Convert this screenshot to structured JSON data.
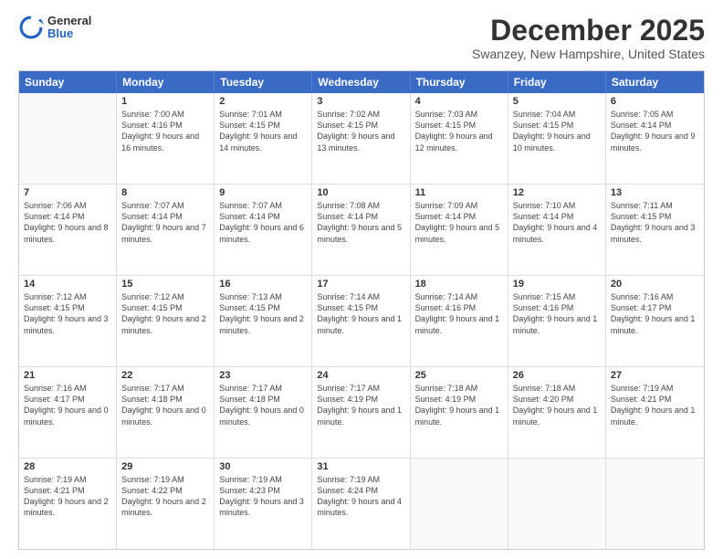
{
  "header": {
    "logo": {
      "general": "General",
      "blue": "Blue"
    },
    "month": "December 2025",
    "location": "Swanzey, New Hampshire, United States"
  },
  "days_of_week": [
    "Sunday",
    "Monday",
    "Tuesday",
    "Wednesday",
    "Thursday",
    "Friday",
    "Saturday"
  ],
  "weeks": [
    [
      {
        "day": "",
        "empty": true
      },
      {
        "day": "1",
        "sunrise": "Sunrise: 7:00 AM",
        "sunset": "Sunset: 4:16 PM",
        "daylight": "Daylight: 9 hours and 16 minutes."
      },
      {
        "day": "2",
        "sunrise": "Sunrise: 7:01 AM",
        "sunset": "Sunset: 4:15 PM",
        "daylight": "Daylight: 9 hours and 14 minutes."
      },
      {
        "day": "3",
        "sunrise": "Sunrise: 7:02 AM",
        "sunset": "Sunset: 4:15 PM",
        "daylight": "Daylight: 9 hours and 13 minutes."
      },
      {
        "day": "4",
        "sunrise": "Sunrise: 7:03 AM",
        "sunset": "Sunset: 4:15 PM",
        "daylight": "Daylight: 9 hours and 12 minutes."
      },
      {
        "day": "5",
        "sunrise": "Sunrise: 7:04 AM",
        "sunset": "Sunset: 4:15 PM",
        "daylight": "Daylight: 9 hours and 10 minutes."
      },
      {
        "day": "6",
        "sunrise": "Sunrise: 7:05 AM",
        "sunset": "Sunset: 4:14 PM",
        "daylight": "Daylight: 9 hours and 9 minutes."
      }
    ],
    [
      {
        "day": "7",
        "sunrise": "Sunrise: 7:06 AM",
        "sunset": "Sunset: 4:14 PM",
        "daylight": "Daylight: 9 hours and 8 minutes."
      },
      {
        "day": "8",
        "sunrise": "Sunrise: 7:07 AM",
        "sunset": "Sunset: 4:14 PM",
        "daylight": "Daylight: 9 hours and 7 minutes."
      },
      {
        "day": "9",
        "sunrise": "Sunrise: 7:07 AM",
        "sunset": "Sunset: 4:14 PM",
        "daylight": "Daylight: 9 hours and 6 minutes."
      },
      {
        "day": "10",
        "sunrise": "Sunrise: 7:08 AM",
        "sunset": "Sunset: 4:14 PM",
        "daylight": "Daylight: 9 hours and 5 minutes."
      },
      {
        "day": "11",
        "sunrise": "Sunrise: 7:09 AM",
        "sunset": "Sunset: 4:14 PM",
        "daylight": "Daylight: 9 hours and 5 minutes."
      },
      {
        "day": "12",
        "sunrise": "Sunrise: 7:10 AM",
        "sunset": "Sunset: 4:14 PM",
        "daylight": "Daylight: 9 hours and 4 minutes."
      },
      {
        "day": "13",
        "sunrise": "Sunrise: 7:11 AM",
        "sunset": "Sunset: 4:15 PM",
        "daylight": "Daylight: 9 hours and 3 minutes."
      }
    ],
    [
      {
        "day": "14",
        "sunrise": "Sunrise: 7:12 AM",
        "sunset": "Sunset: 4:15 PM",
        "daylight": "Daylight: 9 hours and 3 minutes."
      },
      {
        "day": "15",
        "sunrise": "Sunrise: 7:12 AM",
        "sunset": "Sunset: 4:15 PM",
        "daylight": "Daylight: 9 hours and 2 minutes."
      },
      {
        "day": "16",
        "sunrise": "Sunrise: 7:13 AM",
        "sunset": "Sunset: 4:15 PM",
        "daylight": "Daylight: 9 hours and 2 minutes."
      },
      {
        "day": "17",
        "sunrise": "Sunrise: 7:14 AM",
        "sunset": "Sunset: 4:15 PM",
        "daylight": "Daylight: 9 hours and 1 minute."
      },
      {
        "day": "18",
        "sunrise": "Sunrise: 7:14 AM",
        "sunset": "Sunset: 4:16 PM",
        "daylight": "Daylight: 9 hours and 1 minute."
      },
      {
        "day": "19",
        "sunrise": "Sunrise: 7:15 AM",
        "sunset": "Sunset: 4:16 PM",
        "daylight": "Daylight: 9 hours and 1 minute."
      },
      {
        "day": "20",
        "sunrise": "Sunrise: 7:16 AM",
        "sunset": "Sunset: 4:17 PM",
        "daylight": "Daylight: 9 hours and 1 minute."
      }
    ],
    [
      {
        "day": "21",
        "sunrise": "Sunrise: 7:16 AM",
        "sunset": "Sunset: 4:17 PM",
        "daylight": "Daylight: 9 hours and 0 minutes."
      },
      {
        "day": "22",
        "sunrise": "Sunrise: 7:17 AM",
        "sunset": "Sunset: 4:18 PM",
        "daylight": "Daylight: 9 hours and 0 minutes."
      },
      {
        "day": "23",
        "sunrise": "Sunrise: 7:17 AM",
        "sunset": "Sunset: 4:18 PM",
        "daylight": "Daylight: 9 hours and 0 minutes."
      },
      {
        "day": "24",
        "sunrise": "Sunrise: 7:17 AM",
        "sunset": "Sunset: 4:19 PM",
        "daylight": "Daylight: 9 hours and 1 minute."
      },
      {
        "day": "25",
        "sunrise": "Sunrise: 7:18 AM",
        "sunset": "Sunset: 4:19 PM",
        "daylight": "Daylight: 9 hours and 1 minute."
      },
      {
        "day": "26",
        "sunrise": "Sunrise: 7:18 AM",
        "sunset": "Sunset: 4:20 PM",
        "daylight": "Daylight: 9 hours and 1 minute."
      },
      {
        "day": "27",
        "sunrise": "Sunrise: 7:19 AM",
        "sunset": "Sunset: 4:21 PM",
        "daylight": "Daylight: 9 hours and 1 minute."
      }
    ],
    [
      {
        "day": "28",
        "sunrise": "Sunrise: 7:19 AM",
        "sunset": "Sunset: 4:21 PM",
        "daylight": "Daylight: 9 hours and 2 minutes."
      },
      {
        "day": "29",
        "sunrise": "Sunrise: 7:19 AM",
        "sunset": "Sunset: 4:22 PM",
        "daylight": "Daylight: 9 hours and 2 minutes."
      },
      {
        "day": "30",
        "sunrise": "Sunrise: 7:19 AM",
        "sunset": "Sunset: 4:23 PM",
        "daylight": "Daylight: 9 hours and 3 minutes."
      },
      {
        "day": "31",
        "sunrise": "Sunrise: 7:19 AM",
        "sunset": "Sunset: 4:24 PM",
        "daylight": "Daylight: 9 hours and 4 minutes."
      },
      {
        "day": "",
        "empty": true
      },
      {
        "day": "",
        "empty": true
      },
      {
        "day": "",
        "empty": true
      }
    ]
  ]
}
